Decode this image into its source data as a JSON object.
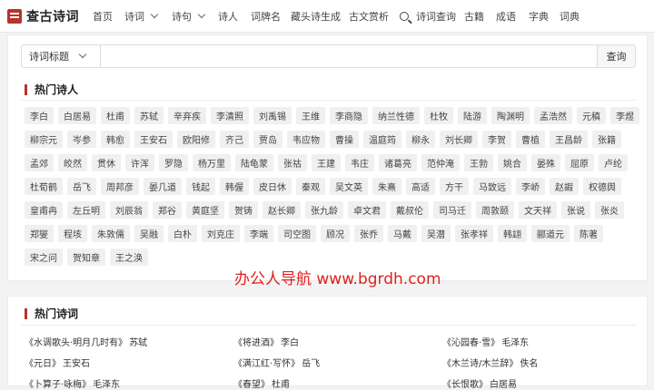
{
  "nav": {
    "logo_text": "查古诗词",
    "items": [
      {
        "label": "首页"
      },
      {
        "label": "诗词"
      },
      {
        "label": "诗句"
      },
      {
        "label": "诗人"
      },
      {
        "label": "词牌名"
      },
      {
        "label": "藏头诗生成"
      },
      {
        "label": "古文赏析"
      },
      {
        "label": "诗词查询"
      },
      {
        "label": "古籍"
      },
      {
        "label": "成语"
      },
      {
        "label": "字典"
      },
      {
        "label": "词典"
      }
    ]
  },
  "search": {
    "select_value": "诗词标题",
    "placeholder": "",
    "button_label": "查询"
  },
  "hot_poets": {
    "title": "热门诗人",
    "poets": [
      "李白",
      "白居易",
      "杜甫",
      "苏轼",
      "辛弃疾",
      "李清照",
      "刘禹锡",
      "王维",
      "李商隐",
      "纳兰性德",
      "杜牧",
      "陆游",
      "陶渊明",
      "孟浩然",
      "元稹",
      "李煜",
      "柳宗元",
      "岑参",
      "韩愈",
      "王安石",
      "欧阳修",
      "齐己",
      "贾岛",
      "韦应物",
      "曹操",
      "温庭筠",
      "柳永",
      "刘长卿",
      "李贺",
      "曹植",
      "王昌龄",
      "张籍",
      "孟郊",
      "皎然",
      "贯休",
      "许浑",
      "罗隐",
      "杨万里",
      "陆龟蒙",
      "张祜",
      "王建",
      "韦庄",
      "诸葛亮",
      "范仲淹",
      "王勃",
      "姚合",
      "晏殊",
      "屈原",
      "卢纶",
      "杜荀鹤",
      "岳飞",
      "周邦彦",
      "晏几道",
      "钱起",
      "韩偓",
      "皮日休",
      "秦观",
      "吴文英",
      "朱熹",
      "高适",
      "方干",
      "马致远",
      "李峤",
      "赵嘏",
      "权德舆",
      "皇甫冉",
      "左丘明",
      "刘辰翁",
      "郑谷",
      "黄庭坚",
      "贺铸",
      "赵长卿",
      "张九龄",
      "卓文君",
      "戴叔伦",
      "司马迁",
      "周敦颐",
      "文天祥",
      "张说",
      "张炎",
      "郑燮",
      "程垓",
      "朱敦儒",
      "吴融",
      "白朴",
      "刘克庄",
      "李端",
      "司空图",
      "顾况",
      "张乔",
      "马戴",
      "吴潜",
      "张孝祥",
      "韩翃",
      "郦道元",
      "陈著",
      "宋之问",
      "贺知章",
      "王之涣"
    ]
  },
  "watermark": "办公人导航 www.bgrdh.com",
  "hot_poems": {
    "title": "热门诗词",
    "poems": [
      {
        "title": "《水调歌头·明月几时有》",
        "author": "苏轼"
      },
      {
        "title": "《将进酒》",
        "author": "李白"
      },
      {
        "title": "《沁园春·雪》",
        "author": "毛泽东"
      },
      {
        "title": "《元日》",
        "author": "王安石"
      },
      {
        "title": "《满江红·写怀》",
        "author": "岳飞"
      },
      {
        "title": "《木兰诗/木兰辞》",
        "author": "佚名"
      },
      {
        "title": "《卜算子·咏梅》",
        "author": "毛泽东"
      },
      {
        "title": "《春望》",
        "author": "杜甫"
      },
      {
        "title": "《长恨歌》",
        "author": "白居易"
      }
    ]
  },
  "colors": {
    "accent": "#b7332b",
    "watermark": "#e02020",
    "page_bg": "#f3f3f3"
  }
}
